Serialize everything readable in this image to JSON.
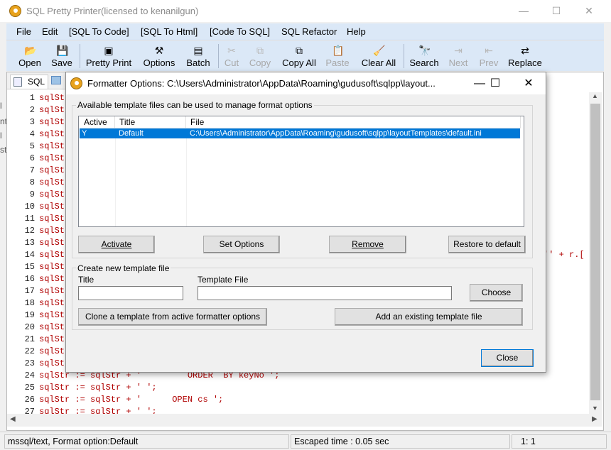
{
  "app": {
    "title": "SQL Pretty Printer(licensed to kenanilgun)",
    "window_controls": {
      "minimize": "—",
      "maximize": "☐",
      "close": "✕"
    }
  },
  "menu": [
    "File",
    "Edit",
    "[SQL To Code]",
    "[SQL To Html]",
    "[Code To SQL]",
    "SQL Refactor",
    "Help"
  ],
  "toolbar": [
    {
      "label": "Open",
      "icon": "open-folder-icon",
      "enabled": true
    },
    {
      "label": "Save",
      "icon": "floppy-disk-icon",
      "enabled": true
    },
    {
      "label": "Pretty Print",
      "icon": "pretty-print-icon",
      "enabled": true
    },
    {
      "label": "Options",
      "icon": "options-hammer-icon",
      "enabled": true
    },
    {
      "label": "Batch",
      "icon": "batch-icon",
      "enabled": true
    },
    {
      "label": "Cut",
      "icon": "scissors-icon",
      "enabled": false
    },
    {
      "label": "Copy",
      "icon": "copy-icon",
      "enabled": false
    },
    {
      "label": "Copy All",
      "icon": "copy-all-icon",
      "enabled": true
    },
    {
      "label": "Paste",
      "icon": "paste-icon",
      "enabled": false
    },
    {
      "label": "Clear All",
      "icon": "broom-icon",
      "enabled": true
    },
    {
      "label": "Search",
      "icon": "binoculars-icon",
      "enabled": true
    },
    {
      "label": "Next",
      "icon": "search-next-icon",
      "enabled": false
    },
    {
      "label": "Prev",
      "icon": "search-prev-icon",
      "enabled": false
    },
    {
      "label": "Replace",
      "icon": "replace-icon",
      "enabled": true
    }
  ],
  "editor": {
    "tab_label": "SQL",
    "left_strip_fragments": [
      "l",
      "nt",
      "l",
      "st"
    ],
    "lines": [
      {
        "n": "1",
        "code": "sqlSt"
      },
      {
        "n": "2",
        "code": "sqlSt"
      },
      {
        "n": "3",
        "code": "sqlSt"
      },
      {
        "n": "4",
        "code": "sqlSt"
      },
      {
        "n": "5",
        "code": "sqlSt"
      },
      {
        "n": "6",
        "code": "sqlSt"
      },
      {
        "n": "7",
        "code": "sqlSt"
      },
      {
        "n": "8",
        "code": "sqlSt"
      },
      {
        "n": "9",
        "code": "sqlSt"
      },
      {
        "n": "10",
        "code": "sqlSt"
      },
      {
        "n": "11",
        "code": "sqlSt"
      },
      {
        "n": "12",
        "code": "sqlSt"
      },
      {
        "n": "13",
        "code": "sqlSt"
      },
      {
        "n": "14",
        "code": "sqlSt"
      },
      {
        "n": "15",
        "code": "sqlSt"
      },
      {
        "n": "16",
        "code": "sqlSt"
      },
      {
        "n": "17",
        "code": "sqlSt"
      },
      {
        "n": "18",
        "code": "sqlSt"
      },
      {
        "n": "19",
        "code": "sqlSt"
      },
      {
        "n": "20",
        "code": "sqlSt"
      },
      {
        "n": "21",
        "code": "sqlSt"
      },
      {
        "n": "22",
        "code": "sqlSt"
      },
      {
        "n": "23",
        "code": "sqlSt"
      },
      {
        "n": "24",
        "code": "sqlStr := sqlStr + '         ORDER  BY keyNo ';"
      },
      {
        "n": "25",
        "code": "sqlStr := sqlStr + ' ';"
      },
      {
        "n": "26",
        "code": "sqlStr := sqlStr + '      OPEN cs ';"
      },
      {
        "n": "27",
        "code": "sqlStr := sqlStr + ' ';"
      }
    ],
    "line14_right_fragment": "'' + r.["
  },
  "status": {
    "left": "mssql/text, Format option:Default",
    "middle": "Escaped time : 0.05 sec",
    "right": "1:  1"
  },
  "dialog": {
    "title": "Formatter Options: C:\\Users\\Administrator\\AppData\\Roaming\\gudusoft\\sqlpp\\layout...",
    "controls": {
      "minimize": "—",
      "maximize": "☐",
      "close": "✕"
    },
    "available_group_label": "Available template files can be used to manage format options",
    "columns": [
      "Active",
      "Title",
      "File"
    ],
    "rows": [
      {
        "active": "Y",
        "title": "Default",
        "file": "C:\\Users\\Administrator\\AppData\\Roaming\\gudusoft\\sqlpp\\layoutTemplates\\default.ini"
      }
    ],
    "buttons": {
      "activate": "Activate",
      "set_options": "Set Options",
      "remove": "Remove",
      "restore": "Restore to default",
      "choose": "Choose",
      "clone": "Clone a template  from active formatter  options",
      "add_existing": "Add an existing template file",
      "close": "Close"
    },
    "create_group_label": "Create new template file",
    "title_label": "Title",
    "template_file_label": "Template File",
    "title_value": "",
    "template_file_value": ""
  }
}
